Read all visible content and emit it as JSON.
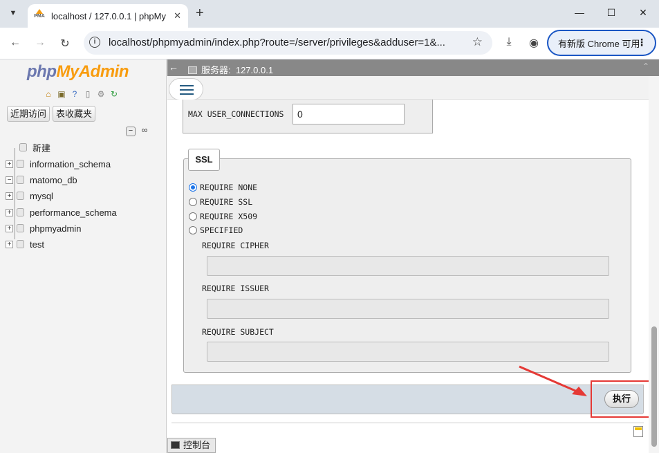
{
  "browser": {
    "tab_title": "localhost / 127.0.0.1 | phpMy",
    "favicon_text": "PMA",
    "url": "localhost/phpmyadmin/index.php?route=/server/privileges&adduser=1&...",
    "update_button": "有新版 Chrome 可用"
  },
  "sidebar": {
    "logo_php": "php",
    "logo_myadmin": "MyAdmin",
    "btn_recent": "近期访问",
    "btn_favorites": "表收藏夹",
    "tree": [
      {
        "label": "新建"
      },
      {
        "label": "information_schema"
      },
      {
        "label": "matomo_db"
      },
      {
        "label": "mysql"
      },
      {
        "label": "performance_schema"
      },
      {
        "label": "phpmyadmin"
      },
      {
        "label": "test"
      }
    ]
  },
  "main": {
    "server_label": "服务器:",
    "server_name": "127.0.0.1",
    "max_user_connections_label": "MAX USER_CONNECTIONS",
    "max_user_connections_value": "0",
    "ssl": {
      "legend": "SSL",
      "options": [
        "REQUIRE NONE",
        "REQUIRE SSL",
        "REQUIRE X509",
        "SPECIFIED"
      ],
      "selected": "REQUIRE NONE",
      "cipher_label": "REQUIRE CIPHER",
      "issuer_label": "REQUIRE ISSUER",
      "subject_label": "REQUIRE SUBJECT"
    },
    "execute_button": "执行",
    "console_label": "控制台"
  },
  "colors": {
    "accent": "#1a73e8",
    "highlight": "#e53935",
    "logo_php": "#6c78af",
    "logo_myadmin": "#f89c0e"
  }
}
